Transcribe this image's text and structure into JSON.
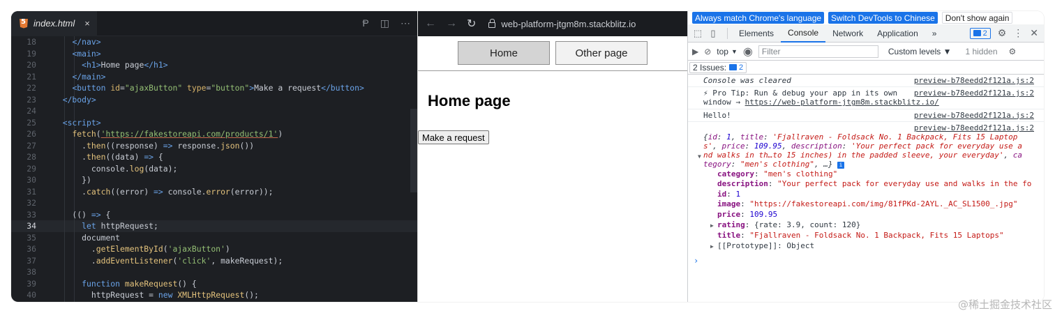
{
  "editor": {
    "tab_label": "index.html",
    "tab_close": "×",
    "lines": [
      {
        "n": "18",
        "html": "    <span class='t-tag'>&lt;/nav&gt;</span>"
      },
      {
        "n": "19",
        "html": "    <span class='t-tag'>&lt;main&gt;</span>"
      },
      {
        "n": "20",
        "html": "      <span class='t-tag'>&lt;h1&gt;</span><span class='t-txt'>Home page</span><span class='t-tag'>&lt;/h1&gt;</span>"
      },
      {
        "n": "21",
        "html": "    <span class='t-tag'>&lt;/main&gt;</span>"
      },
      {
        "n": "22",
        "html": "    <span class='t-tag'>&lt;button</span> <span class='t-attr'>id</span>=<span class='t-str'>\"ajaxButton\"</span> <span class='t-attr'>type</span>=<span class='t-str'>\"button\"</span><span class='t-tag'>&gt;</span><span class='t-txt'>Make a request</span><span class='t-tag'>&lt;/button&gt;</span>"
      },
      {
        "n": "23",
        "html": "  <span class='t-tag'>&lt;/body&gt;</span>"
      },
      {
        "n": "24",
        "html": ""
      },
      {
        "n": "25",
        "html": "  <span class='t-tag'>&lt;script&gt;</span>"
      },
      {
        "n": "26",
        "html": "    <span class='t-fn'>fetch</span>(<span class='t-url'>'https://fakestoreapi.com/products/1'</span>)"
      },
      {
        "n": "27",
        "html": "      .<span class='t-fn'>then</span>((<span class='t-txt'>response</span>) <span class='t-kw'>=&gt;</span> <span class='t-txt'>response</span>.<span class='t-fn'>json</span>())"
      },
      {
        "n": "28",
        "html": "      .<span class='t-fn'>then</span>((<span class='t-txt'>data</span>) <span class='t-kw'>=&gt;</span> {"
      },
      {
        "n": "29",
        "html": "        <span class='t-txt'>console</span>.<span class='t-fn'>log</span>(<span class='t-txt'>data</span>);"
      },
      {
        "n": "30",
        "html": "      })"
      },
      {
        "n": "31",
        "html": "      .<span class='t-fn'>catch</span>((<span class='t-txt'>error</span>) <span class='t-kw'>=&gt;</span> <span class='t-txt'>console</span>.<span class='t-fn'>error</span>(<span class='t-txt'>error</span>));"
      },
      {
        "n": "32",
        "html": ""
      },
      {
        "n": "33",
        "html": "    (() <span class='t-kw'>=&gt;</span> {"
      },
      {
        "n": "34",
        "html": "      <span class='t-kw'>let</span> <span class='t-txt'>httpRequest</span>;",
        "active": true
      },
      {
        "n": "35",
        "html": "      <span class='t-txt'>document</span>"
      },
      {
        "n": "36",
        "html": "        .<span class='t-fn'>getElementById</span>(<span class='t-str'>'ajaxButton'</span>)"
      },
      {
        "n": "37",
        "html": "        .<span class='t-fn'>addEventListener</span>(<span class='t-str'>'click'</span>, <span class='t-txt'>makeRequest</span>);"
      },
      {
        "n": "38",
        "html": ""
      },
      {
        "n": "39",
        "html": "      <span class='t-kw'>function</span> <span class='t-fn'>makeRequest</span>() {"
      },
      {
        "n": "40",
        "html": "        <span class='t-txt'>httpRequest</span> = <span class='t-kw'>new</span> <span class='t-fn'>XMLHttpRequest</span>();"
      }
    ]
  },
  "preview": {
    "url": "web-platform-jtgm8m.stackblitz.io",
    "nav_home": "Home",
    "nav_other": "Other page",
    "heading": "Home page",
    "button_label": "Make a request"
  },
  "devtools": {
    "lang_match": "Always match Chrome's language",
    "lang_switch": "Switch DevTools to Chinese",
    "lang_dismiss": "Don't show again",
    "tabs": [
      "Elements",
      "Console",
      "Network",
      "Application"
    ],
    "active_tab": "Console",
    "more_tabs": "»",
    "issues_badge_count": "2",
    "context": "top",
    "filter_placeholder": "Filter",
    "levels": "Custom levels ▼",
    "hidden_count": "1 hidden",
    "issues_label": "2 Issues:",
    "issues_count": "2",
    "messages": {
      "cleared": "Console was cleared",
      "cleared_src": "preview-b78eedd2f121a.js:2",
      "tip_line1": "⚡ Pro Tip: Run & debug your app in its own",
      "tip_line2_prefix": "window → ",
      "tip_link": "https://web-platform-jtgm8m.stackblitz.io/",
      "tip_src": "preview-b78eedd2f121a.js:2",
      "hello": "Hello!",
      "hello_src": "preview-b78eedd2f121a.js:2",
      "obj_src": "preview-b78eedd2f121a.js:2"
    },
    "object_props": [
      {
        "key": "category",
        "value": "\"men's clothing\"",
        "type": "s"
      },
      {
        "key": "description",
        "value": "\"Your perfect pack for everyday use and walks in the fo",
        "type": "s"
      },
      {
        "key": "id",
        "value": "1",
        "type": "n"
      },
      {
        "key": "image",
        "value": "\"https://fakestoreapi.com/img/81fPKd-2AYL._AC_SL1500_.jpg\"",
        "type": "s"
      },
      {
        "key": "price",
        "value": "109.95",
        "type": "n"
      },
      {
        "key": "rating",
        "value": "{rate: 3.9, count: 120}",
        "type": "o",
        "expandable": true
      },
      {
        "key": "title",
        "value": "\"Fjallraven - Foldsack No. 1 Backpack, Fits 15 Laptops\"",
        "type": "s"
      },
      {
        "key": "[[Prototype]]",
        "value": "Object",
        "type": "o",
        "expandable": true,
        "plain_key": true
      }
    ],
    "prompt": "›"
  },
  "watermark": "@稀土掘金技术社区"
}
